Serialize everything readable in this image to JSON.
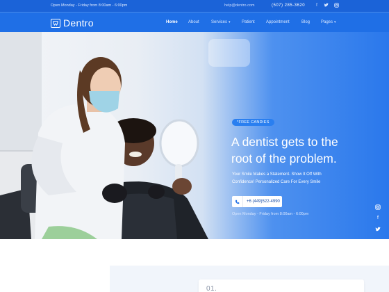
{
  "topbar": {
    "hours": "Open Monday - Friday from 8:00am - 6:00pm",
    "email": "help@dentro.com",
    "phone": "(507) 285-3620",
    "social": [
      "facebook-icon",
      "twitter-icon",
      "instagram-icon"
    ]
  },
  "nav": {
    "logo": "Dentro",
    "items": [
      "Home",
      "About",
      "Services",
      "Patient",
      "Appointment",
      "Blog",
      "Pages"
    ],
    "active": "Home"
  },
  "hero": {
    "tag": "*FREE CANDIES",
    "headline_line1": "A dentist gets to the",
    "headline_line2": "root of the problem.",
    "sub_line1": "Your Smile Makes a Statement. Show It Off With",
    "sub_line2": "Confidence! Personalized Care For Every Smile",
    "phone": "+6 (449)522-4990",
    "hours": "Open Monday - Friday from 8:00am - 6:00pm",
    "social": [
      "instagram-icon",
      "facebook-icon",
      "twitter-icon"
    ]
  },
  "lower": {
    "card_number": "01."
  },
  "colors": {
    "primary": "#1f6fe6",
    "topbar": "#1b63d8",
    "accent_tag": "#2a7ff0"
  }
}
